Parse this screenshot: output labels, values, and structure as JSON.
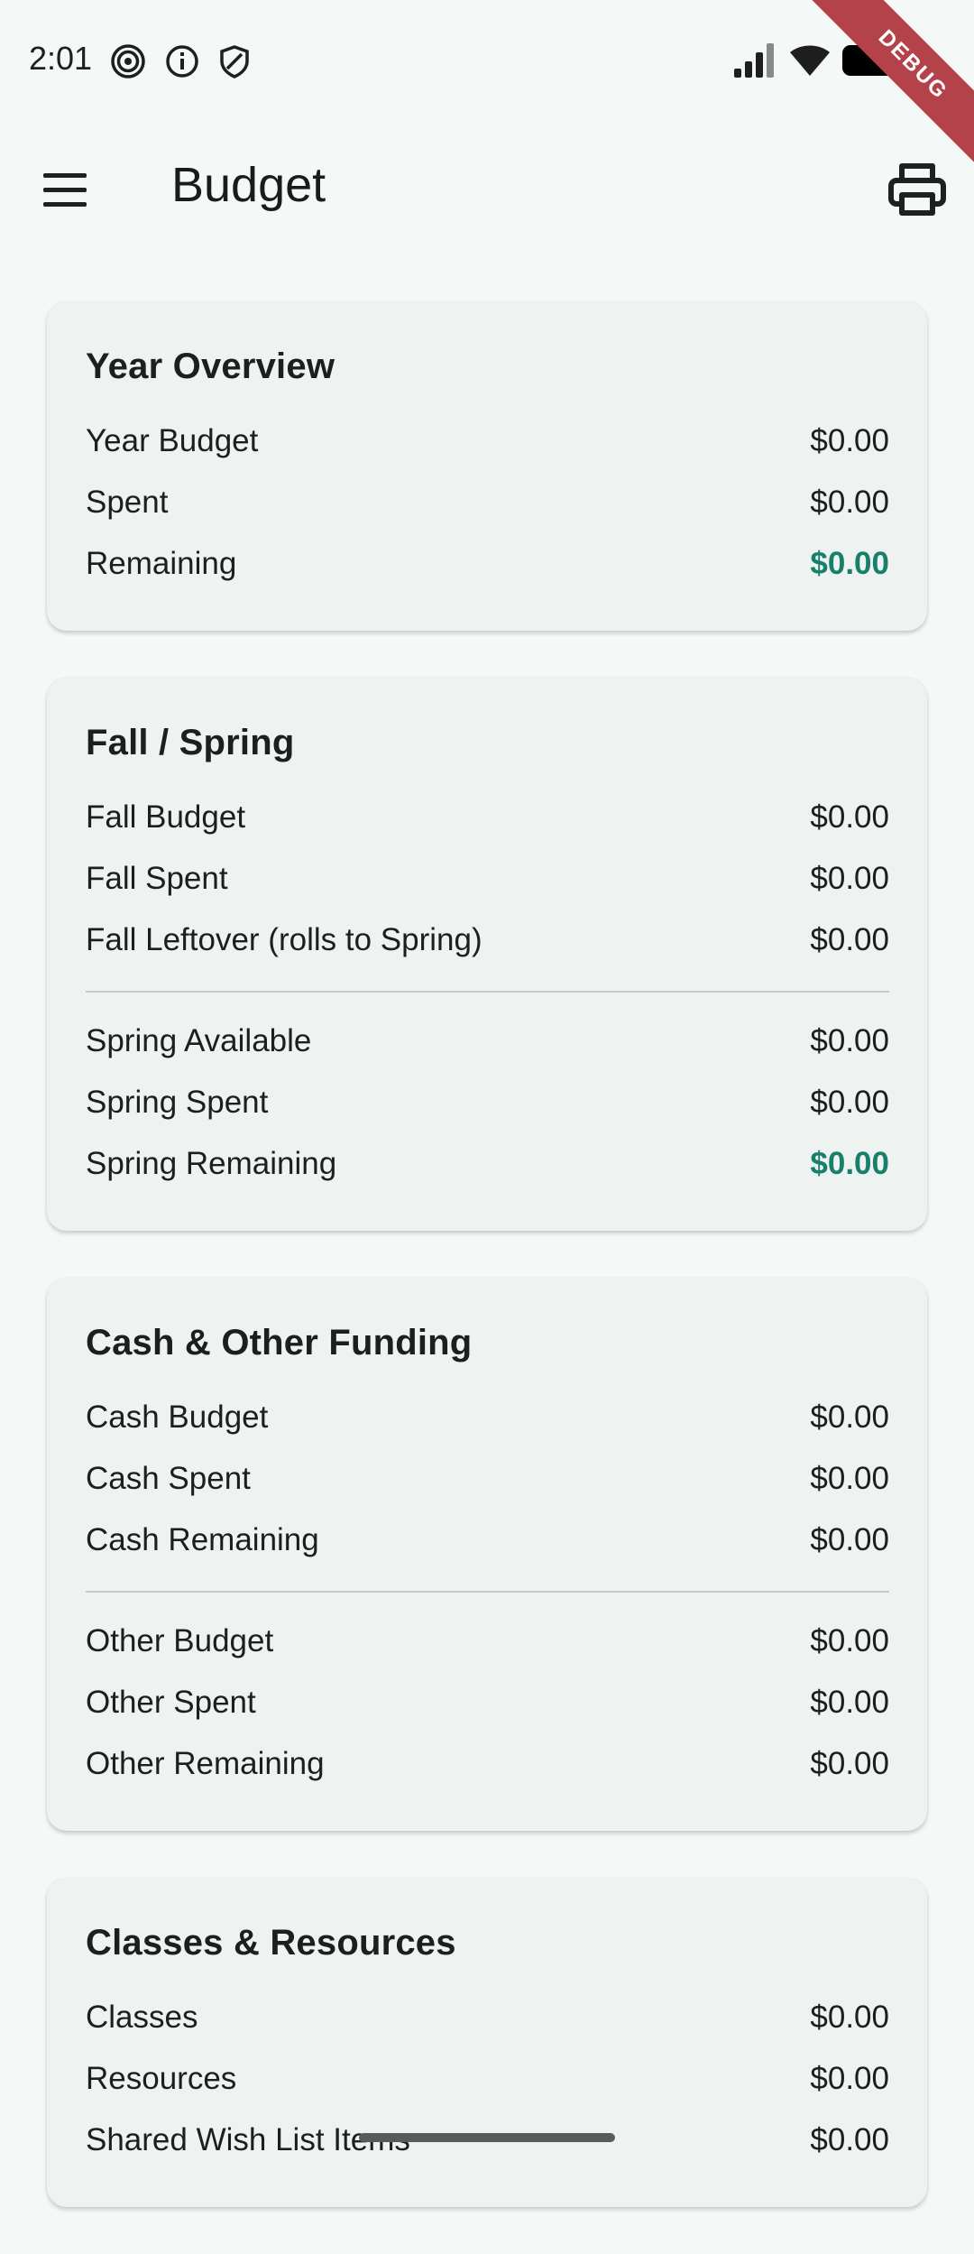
{
  "status_bar": {
    "time": "2:01",
    "icons": [
      "spiral-notification-icon",
      "info-icon",
      "shield-icon"
    ],
    "right_icons": [
      "signal-icon",
      "wifi-icon",
      "battery-icon"
    ],
    "debug_banner": "DEBUG"
  },
  "app_bar": {
    "title": "Budget",
    "menu_icon": "menu-icon",
    "print_icon": "print-icon"
  },
  "colors": {
    "accent": "#17806c",
    "background": "#f4f9f7",
    "card": "#eef3f1",
    "debug": "#b3424a"
  },
  "cards": [
    {
      "title": "Year Overview",
      "groups": [
        [
          {
            "label": "Year Budget",
            "value": "$0.00"
          },
          {
            "label": "Spent",
            "value": "$0.00"
          },
          {
            "label": "Remaining",
            "value": "$0.00",
            "accent": true
          }
        ]
      ]
    },
    {
      "title": "Fall / Spring",
      "groups": [
        [
          {
            "label": "Fall Budget",
            "value": "$0.00"
          },
          {
            "label": "Fall Spent",
            "value": "$0.00"
          },
          {
            "label": "Fall Leftover (rolls to Spring)",
            "value": "$0.00"
          }
        ],
        [
          {
            "label": "Spring Available",
            "value": "$0.00"
          },
          {
            "label": "Spring Spent",
            "value": "$0.00"
          },
          {
            "label": "Spring Remaining",
            "value": "$0.00",
            "accent": true
          }
        ]
      ]
    },
    {
      "title": "Cash & Other Funding",
      "groups": [
        [
          {
            "label": "Cash Budget",
            "value": "$0.00"
          },
          {
            "label": "Cash Spent",
            "value": "$0.00"
          },
          {
            "label": "Cash Remaining",
            "value": "$0.00"
          }
        ],
        [
          {
            "label": "Other Budget",
            "value": "$0.00"
          },
          {
            "label": "Other Spent",
            "value": "$0.00"
          },
          {
            "label": "Other Remaining",
            "value": "$0.00"
          }
        ]
      ]
    },
    {
      "title": "Classes & Resources",
      "groups": [
        [
          {
            "label": "Classes",
            "value": "$0.00"
          },
          {
            "label": "Resources",
            "value": "$0.00"
          },
          {
            "label": "Shared Wish List Items",
            "value": "$0.00"
          }
        ]
      ]
    }
  ]
}
